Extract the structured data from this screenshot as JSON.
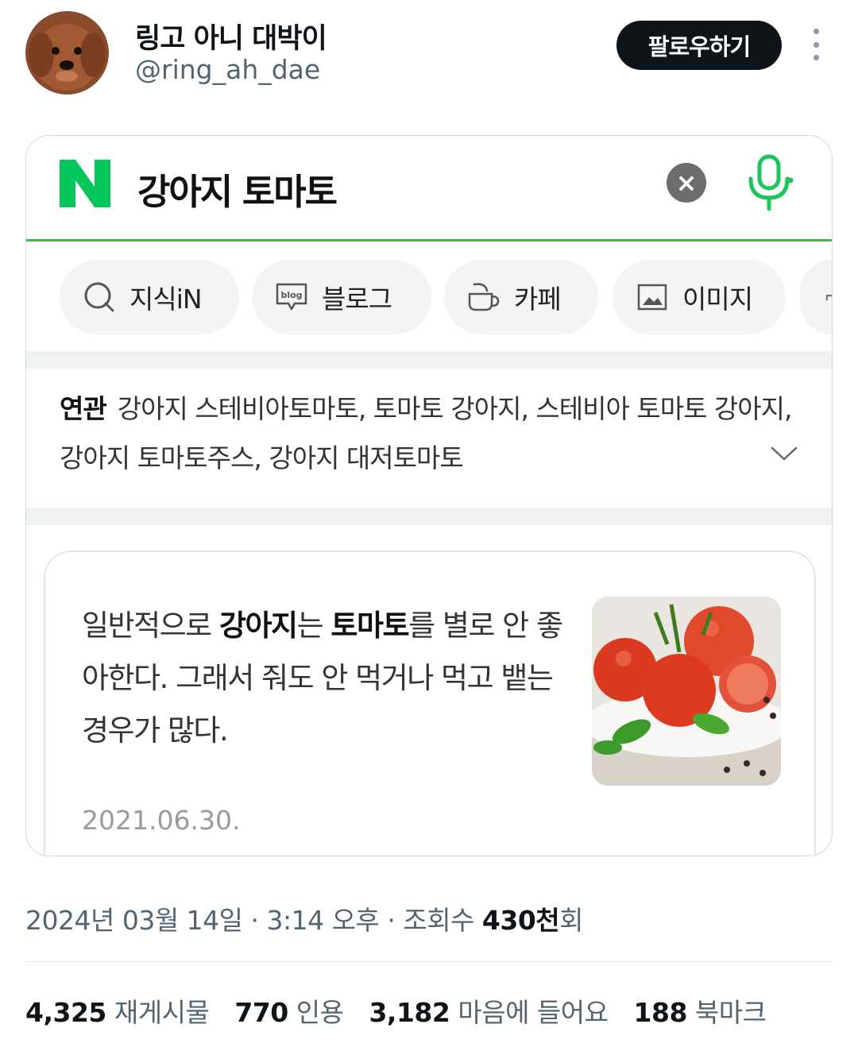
{
  "tweet": {
    "author_name": "링고 아니 대박이",
    "author_handle": "@ring_ah_dae",
    "follow_label": "팔로우하기",
    "meta": {
      "date": "2024년 03월 14일",
      "sep1": " · ",
      "time": "3:14 오후",
      "sep2": " · ",
      "views_label": "조회수 ",
      "views_count": "430천",
      "views_suffix": "회"
    },
    "stats": [
      {
        "count": "4,325",
        "label": "재게시물"
      },
      {
        "count": "770",
        "label": "인용"
      },
      {
        "count": "3,182",
        "label": "마음에 들어요"
      },
      {
        "count": "188",
        "label": "북마크"
      }
    ]
  },
  "screenshot": {
    "search_query": "강아지 토마토",
    "tabs": [
      {
        "label": "지식iN",
        "icon": "magnifier-q-icon"
      },
      {
        "label": "블로그",
        "icon": "blog-bubble-icon"
      },
      {
        "label": "카페",
        "icon": "cafe-cup-icon"
      },
      {
        "label": "이미지",
        "icon": "image-icon"
      }
    ],
    "related_label": "연관",
    "related_text": "강아지 스테비아토마토, 토마토 강아지, 스테비아 토마토 강아지, 강아지 토마토주스, 강아지 대저토마토",
    "knowledge": {
      "t1": "일반적으로 ",
      "b1": "강아지",
      "t2": "는 ",
      "b2": "토마토",
      "t3": "를 별로 안 좋아한다. 그래서 줘도 안 먹거나 먹고 뱉는 경우가 많다.",
      "date": "2021.06.30."
    }
  },
  "colors": {
    "naver_green": "#03c75a",
    "accent_line": "#4caf50",
    "follow_bg": "#0f1419"
  }
}
